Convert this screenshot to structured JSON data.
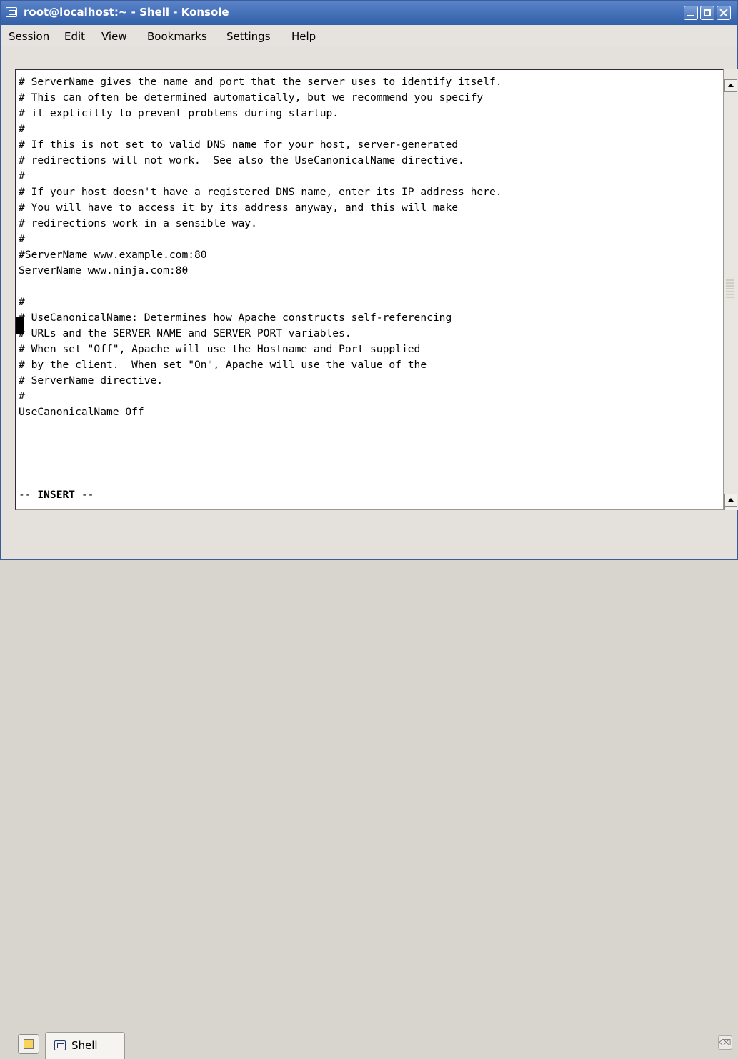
{
  "window": {
    "title": "root@localhost:~ - Shell - Konsole"
  },
  "menubar": {
    "items": [
      "Session",
      "Edit",
      "View",
      "Bookmarks",
      "Settings",
      "Help"
    ]
  },
  "terminal": {
    "lines": [
      "# ServerName gives the name and port that the server uses to identify itself.",
      "# This can often be determined automatically, but we recommend you specify",
      "# it explicitly to prevent problems during startup.",
      "#",
      "# If this is not set to valid DNS name for your host, server-generated",
      "# redirections will not work.  See also the UseCanonicalName directive.",
      "#",
      "# If your host doesn't have a registered DNS name, enter its IP address here.",
      "# You will have to access it by its address anyway, and this will make",
      "# redirections work in a sensible way.",
      "#",
      "#ServerName www.example.com:80",
      "ServerName www.ninja.com:80",
      "",
      "#",
      "# UseCanonicalName: Determines how Apache constructs self-referencing",
      "# URLs and the SERVER_NAME and SERVER_PORT variables.",
      "# When set \"Off\", Apache will use the Hostname and Port supplied",
      "# by the client.  When set \"On\", Apache will use the value of the",
      "# ServerName directive.",
      "#",
      "UseCanonicalName Off"
    ],
    "status_prefix": "-- ",
    "status_mode": "INSERT",
    "status_suffix": " --"
  },
  "tabs": {
    "shell_label": "Shell"
  },
  "colors": {
    "titlebar": "#3f6ab4",
    "terminal_bg": "#ffffff",
    "text": "#000000"
  }
}
